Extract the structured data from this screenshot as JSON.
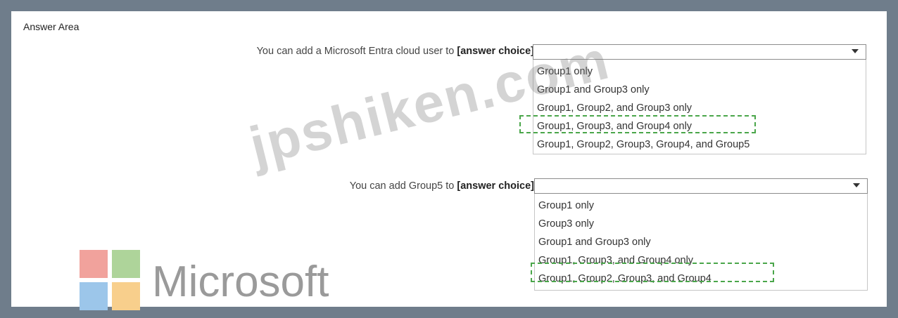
{
  "answer_area": {
    "title": "Answer Area"
  },
  "questions": [
    {
      "prompt_prefix": "You can add a Microsoft Entra cloud user to ",
      "prompt_choice": "[answer choice]",
      "prompt_suffix": ".",
      "selected_value": "",
      "options": [
        "Group1 only",
        "Group1 and Group3 only",
        "Group1, Group2, and Group3 only",
        "Group1, Group3, and Group4 only",
        "Group1, Group2, Group3, Group4, and Group5"
      ],
      "highlighted_option": "Group1, Group3, and Group4 only"
    },
    {
      "prompt_prefix": "You can add Group5 to ",
      "prompt_choice": "[answer choice]",
      "prompt_suffix": ".",
      "selected_value": "",
      "options": [
        "Group1 only",
        "Group3 only",
        "Group1 and Group3 only",
        "Group1, Group3, and Group4 only",
        "Group1, Group2, Group3, and Group4"
      ],
      "highlighted_option": "Group1, Group2, Group3, and Group4"
    }
  ],
  "watermark": {
    "text": "jpshiken.com"
  },
  "logo": {
    "text": "Microsoft"
  },
  "colors": {
    "frame": "#6f7d8b",
    "highlight": "#4aa64a",
    "logo_red": "#f1a29c",
    "logo_green": "#aed49a",
    "logo_blue": "#9cc6ea",
    "logo_yellow": "#f8cf8c"
  }
}
